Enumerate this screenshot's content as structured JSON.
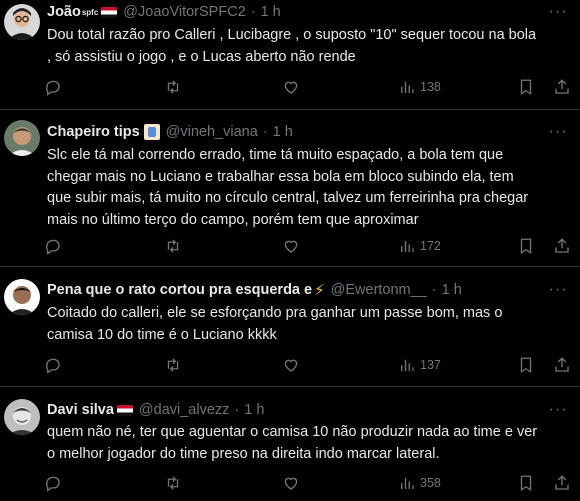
{
  "tweets": [
    {
      "name": "João",
      "name_sup": "spfc",
      "handle": "@JoaoVitorSPFC2",
      "time": "1 h",
      "text": "Dou total razão pro Calleri , Lucibagre , o suposto \"10\" sequer tocou na bola\n, só assistiu o jogo , e o Lucas aberto não rende",
      "views": "138",
      "badge": "flag"
    },
    {
      "name": "Chapeiro tips",
      "handle": "@vineh_viana",
      "time": "1 h",
      "text": "Slc ele tá mal correndo errado, time tá muito espaçado, a bola tem que\nchegar mais no Luciano e trabalhar essa bola em bloco subindo ela, tem\nque subir mais, tá muito no círculo central, talvez um ferreirinha pra chegar\nmais no último terço do campo, porém tem que aproximar",
      "views": "172",
      "badge": "emoji"
    },
    {
      "name": "Pena que o rato cortou pra esquerda e",
      "handle": "@Ewertonm__",
      "time": "1 h",
      "text": "Coitado do calleri, ele se esforçando pra ganhar um passe bom, mas o\ncamisa 10 do time é o Luciano kkkk",
      "views": "137",
      "badge": "bolt"
    },
    {
      "name": "Davi silva",
      "handle": "@davi_alvezz",
      "time": "1 h",
      "text": "quem não né, ter que aguentar o camisa 10 não produzir nada ao time e ver\no melhor jogador do time preso na direita indo marcar lateral.",
      "views": "358",
      "badge": "flag"
    }
  ],
  "icons": {
    "reply": "reply-icon",
    "retweet": "retweet-icon",
    "like": "heart-icon",
    "views": "views-icon",
    "bookmark": "bookmark-icon",
    "share": "share-icon",
    "more": "more-icon"
  },
  "colors": {
    "background": "#000000",
    "text": "#e7e9ea",
    "muted": "#71767b",
    "divider": "#2f3336"
  }
}
